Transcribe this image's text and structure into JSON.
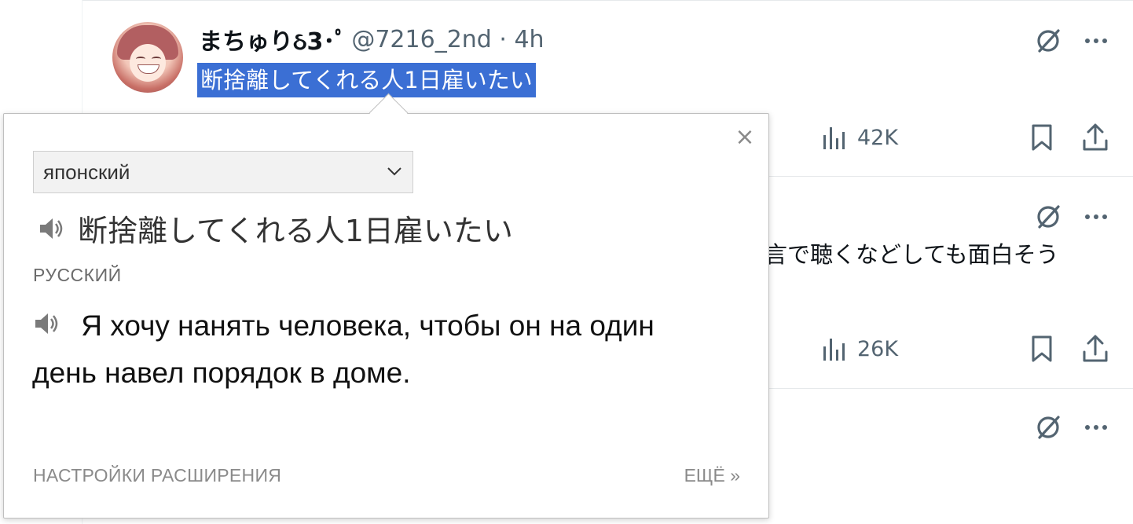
{
  "tweets": [
    {
      "display_name": "まちゅりઠ3･ﾟ",
      "handle_meta": "@7216_2nd · 4h",
      "text": "断捨離してくれる人1日雇いたい",
      "views": "42K"
    },
    {
      "text_fragment": "言で聴くなどしても面白そう",
      "views": "26K"
    }
  ],
  "popup": {
    "close_symbol": "×",
    "source_language": "японский",
    "source_text": "断捨離してくれる人1日雇いたい",
    "target_language": "РУССКИЙ",
    "target_text": "Я хочу нанять человека, чтобы он на один день навел порядок в доме.",
    "settings_link": "НАСТРОЙКИ РАСШИРЕНИЯ",
    "more_link": "ЕЩЁ »"
  },
  "colors": {
    "selection": "#3b6fd4",
    "muted": "#536471",
    "icon": "#536471"
  },
  "icons": [
    "grok-icon",
    "more-icon",
    "views-icon",
    "bookmark-icon",
    "share-icon",
    "speaker-icon",
    "close-icon",
    "chevron-down-icon"
  ]
}
